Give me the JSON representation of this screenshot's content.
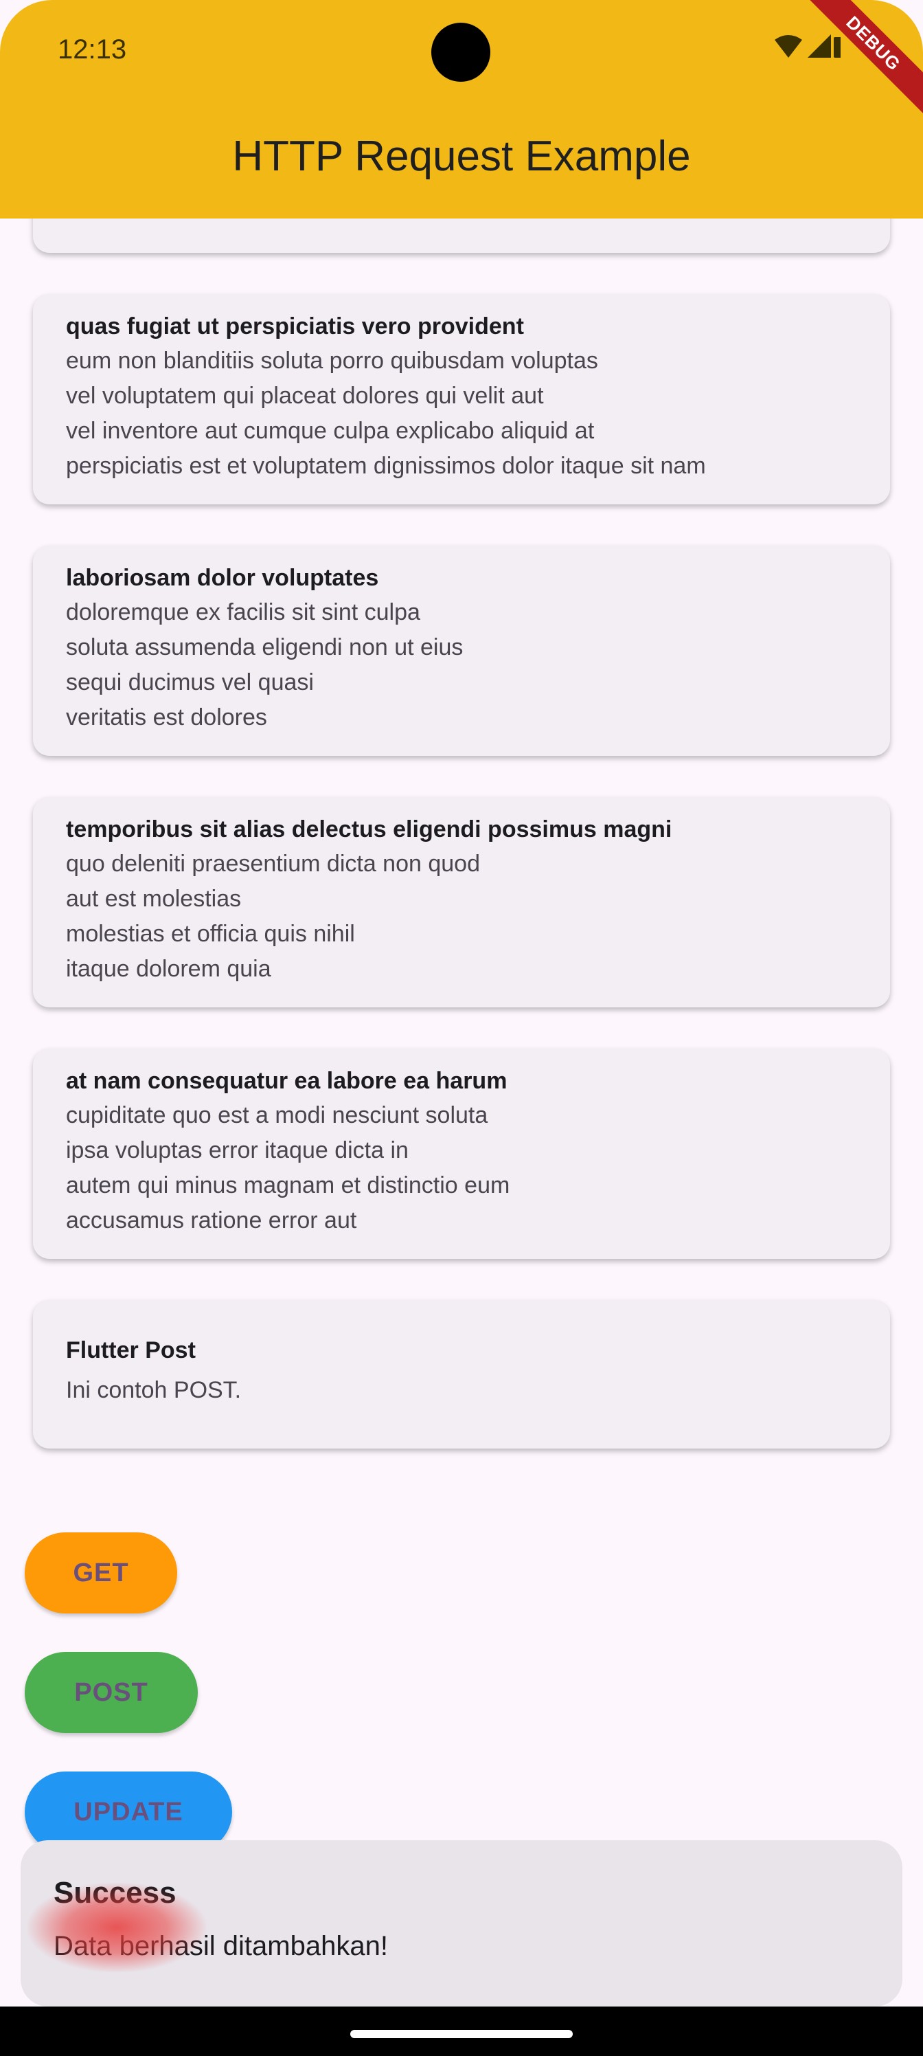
{
  "status_bar": {
    "time": "12:13",
    "icons": [
      "wifi-icon",
      "signal-icon",
      "battery-icon"
    ]
  },
  "debug_banner": "DEBUG",
  "app_bar": {
    "title": "HTTP Request Example",
    "color": "#f2b815"
  },
  "posts": [
    {
      "title": "",
      "body": ""
    },
    {
      "title": "quas fugiat ut perspiciatis vero provident",
      "body": "eum non blanditiis soluta porro quibusdam voluptas\nvel voluptatem qui placeat dolores qui velit aut\nvel inventore aut cumque culpa explicabo aliquid at\nperspiciatis est et voluptatem dignissimos dolor itaque sit nam"
    },
    {
      "title": "laboriosam dolor voluptates",
      "body": "doloremque ex facilis sit sint culpa\nsoluta assumenda eligendi non ut eius\nsequi ducimus vel quasi\nveritatis est dolores"
    },
    {
      "title": "temporibus sit alias delectus eligendi possimus magni",
      "body": "quo deleniti praesentium dicta non quod\naut est molestias\nmolestias et officia quis nihil\nitaque dolorem quia"
    },
    {
      "title": "at nam consequatur ea labore ea harum",
      "body": "cupiditate quo est a modi nesciunt soluta\nipsa voluptas error itaque dicta in\nautem qui minus magnam et distinctio eum\naccusamus ratione error aut"
    },
    {
      "title": "Flutter Post",
      "body": "Ini contoh POST."
    }
  ],
  "buttons": {
    "get": {
      "label": "GET",
      "color": "#fe9a08"
    },
    "post": {
      "label": "POST",
      "color": "#4caf50"
    },
    "update": {
      "label": "UPDATE",
      "color": "#2196f3"
    }
  },
  "snackbar": {
    "title": "Success",
    "message": "Data berhasil ditambahkan!"
  }
}
